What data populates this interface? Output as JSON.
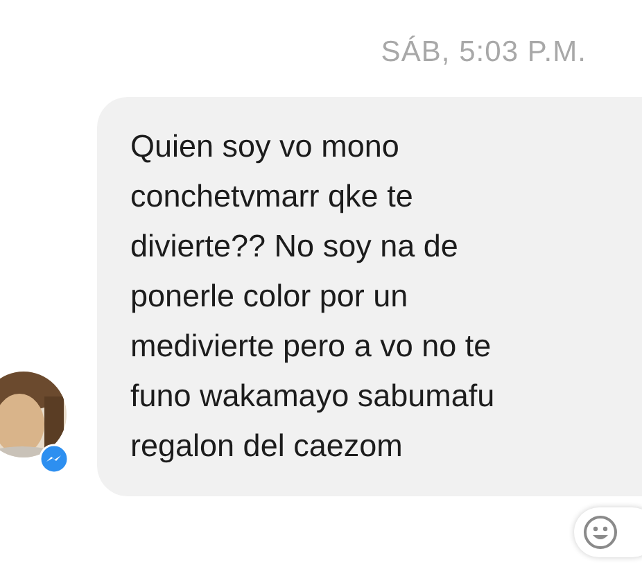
{
  "timestamp": "SÁB, 5:03 P.M.",
  "message": {
    "lines": [
      "Quien soy vo mono",
      "conchetvmarr qke te",
      "divierte?? No soy na de",
      "ponerle color por un",
      "medivierte pero a vo no te",
      "funo wakamayo sabumafu",
      "regalon del caezom"
    ]
  }
}
